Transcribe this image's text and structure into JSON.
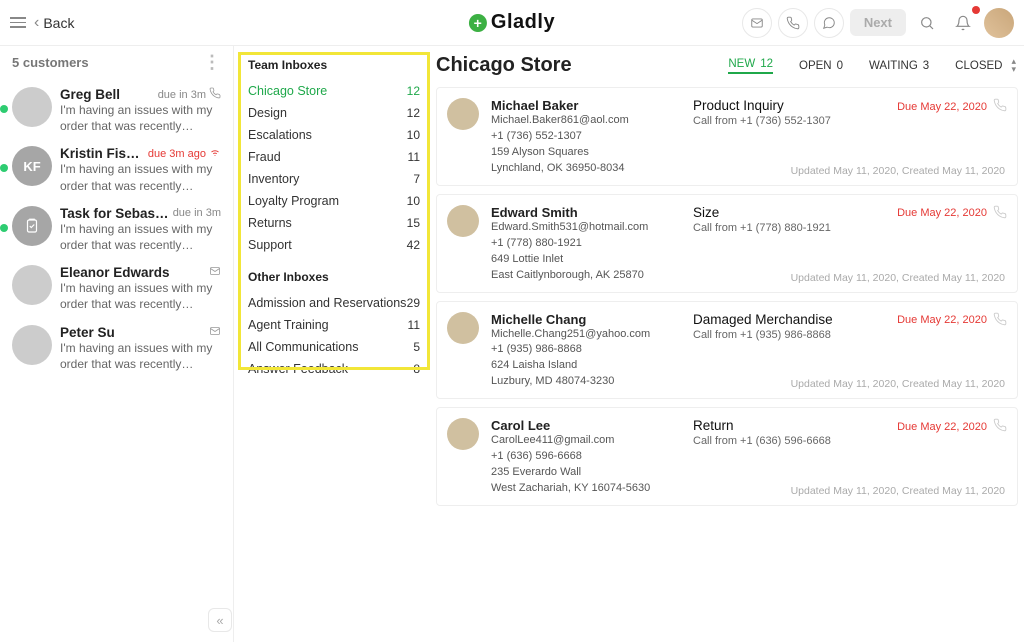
{
  "topbar": {
    "back_label": "Back",
    "brand": "Gladly",
    "next_label": "Next"
  },
  "sidebar": {
    "count_label": "5 customers",
    "default_preview": "I'm having an issues with my order that was recently shipped...",
    "items": [
      {
        "name": "Greg Bell",
        "meta": "due in 3m",
        "meta_red": false,
        "status": true,
        "icon": "phone",
        "avatar": "photo"
      },
      {
        "name": "Kristin Fisher",
        "meta": "due 3m ago",
        "meta_red": true,
        "status": true,
        "icon": "wifi",
        "avatar": "KF"
      },
      {
        "name": "Task for Sebasta...",
        "meta": "due in 3m",
        "meta_red": false,
        "status": true,
        "icon": "",
        "avatar": "task"
      },
      {
        "name": "Eleanor Edwards",
        "meta": "",
        "meta_red": false,
        "status": false,
        "icon": "mail",
        "avatar": "photo"
      },
      {
        "name": "Peter Su",
        "meta": "",
        "meta_red": false,
        "status": false,
        "icon": "mail",
        "avatar": "photo"
      }
    ]
  },
  "inbox": {
    "team_title": "Team Inboxes",
    "other_title": "Other Inboxes",
    "team": [
      {
        "label": "Chicago Store",
        "count": "12",
        "active": true
      },
      {
        "label": "Design",
        "count": "12"
      },
      {
        "label": "Escalations",
        "count": "10"
      },
      {
        "label": "Fraud",
        "count": "11"
      },
      {
        "label": "Inventory",
        "count": "7"
      },
      {
        "label": "Loyalty Program",
        "count": "10"
      },
      {
        "label": "Returns",
        "count": "15"
      },
      {
        "label": "Support",
        "count": "42"
      }
    ],
    "other": [
      {
        "label": "Admission and Reservations",
        "count": "29"
      },
      {
        "label": "Agent Training",
        "count": "11"
      },
      {
        "label": "All Communications",
        "count": "5"
      },
      {
        "label": "Answer Feedback",
        "count": "8"
      }
    ]
  },
  "main": {
    "title": "Chicago Store",
    "tabs": [
      {
        "label": "NEW",
        "count": "12",
        "active": true
      },
      {
        "label": "OPEN",
        "count": "0"
      },
      {
        "label": "WAITING",
        "count": "3"
      },
      {
        "label": "CLOSED",
        "count": ""
      }
    ],
    "default_footer": "Updated May 11, 2020, Created May 11, 2020",
    "default_due": "Due May 22, 2020",
    "cards": [
      {
        "name": "Michael Baker",
        "email": "Michael.Baker861@aol.com",
        "phone": "+1 (736) 552-1307",
        "addr1": "159 Alyson Squares",
        "addr2": "Lynchland, OK 36950-8034",
        "subject": "Product Inquiry",
        "callfrom": "Call from +1 (736) 552-1307"
      },
      {
        "name": "Edward Smith",
        "email": "Edward.Smith531@hotmail.com",
        "phone": "+1 (778) 880-1921",
        "addr1": "649 Lottie Inlet",
        "addr2": "East Caitlynborough, AK 25870",
        "subject": "Size",
        "callfrom": "Call from +1 (778) 880-1921"
      },
      {
        "name": "Michelle Chang",
        "email": "Michelle.Chang251@yahoo.com",
        "phone": "+1 (935) 986-8868",
        "addr1": "624 Laisha Island",
        "addr2": "Luzbury, MD 48074-3230",
        "subject": "Damaged Merchandise",
        "callfrom": "Call from +1 (935) 986-8868"
      },
      {
        "name": "Carol Lee",
        "email": "CarolLee411@gmail.com",
        "phone": "+1 (636) 596-6668",
        "addr1": "235 Everardo Wall",
        "addr2": "West Zachariah, KY 16074-5630",
        "subject": "Return",
        "callfrom": "Call from +1 (636) 596-6668"
      }
    ]
  }
}
